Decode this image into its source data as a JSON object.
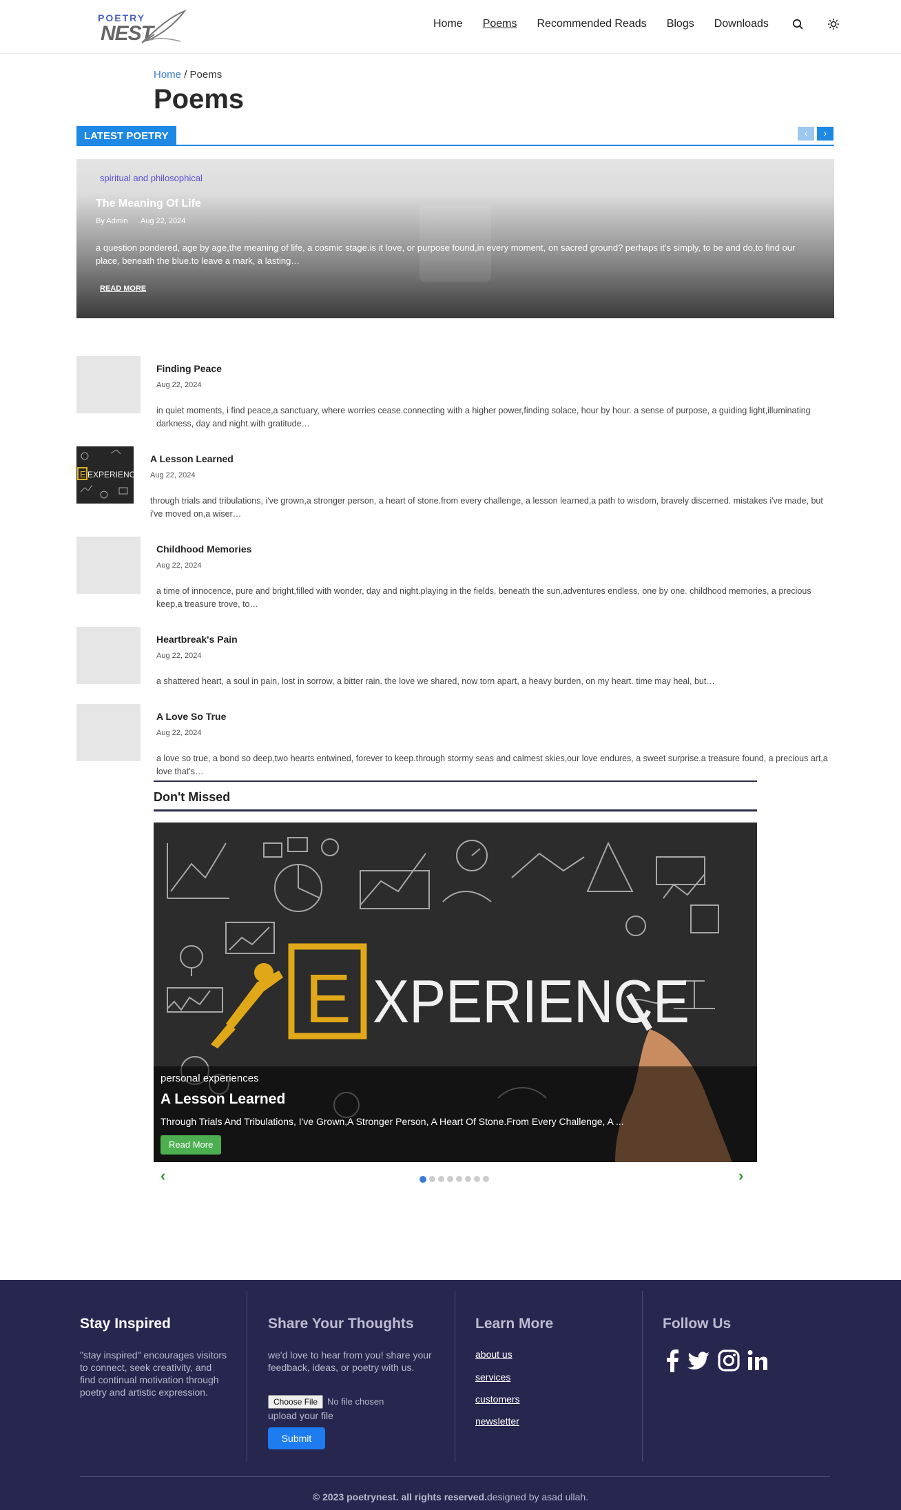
{
  "logo": {
    "line1": "POETRY",
    "line2": "NEST"
  },
  "nav": {
    "items": [
      "Home",
      "Poems",
      "Recommended Reads",
      "Blogs",
      "Downloads"
    ],
    "active": "Poems"
  },
  "breadcrumb": {
    "home": "Home",
    "sep": "/",
    "current": "Poems"
  },
  "page_title": "Poems",
  "latest": {
    "label": "LATEST POETRY",
    "prev": "‹",
    "next": "›"
  },
  "hero": {
    "category": "spiritual and philosophical",
    "title": "The Meaning Of Life",
    "author": "By  Admin",
    "date": "Aug 22, 2024",
    "excerpt": "a question pondered, age by age,the meaning of life, a cosmic stage.is it love, or purpose found,in every moment, on sacred ground? perhaps it's simply, to be and do,to find our place, beneath the blue.to leave a mark, a lasting…",
    "read_more": "READ MORE"
  },
  "posts": [
    {
      "title": "Finding Peace",
      "date": "Aug 22, 2024",
      "excerpt": "in quiet moments, i find peace,a sanctuary, where worries cease.connecting with a higher power,finding solace, hour by hour. a sense of purpose, a guiding light,illuminating darkness, day and night.with gratitude…"
    },
    {
      "title": "A Lesson Learned",
      "date": "Aug 22, 2024",
      "excerpt": "through trials and tribulations, i've grown,a stronger person, a heart of stone.from every challenge, a lesson learned,a path to wisdom, bravely discerned. mistakes i've made, but i've moved on,a wiser…"
    },
    {
      "title": "Childhood Memories",
      "date": "Aug 22, 2024",
      "excerpt": "a time of innocence, pure and bright,filled with wonder, day and night.playing in the fields, beneath the sun,adventures endless, one by one. childhood memories, a precious keep,a treasure trove, to…"
    },
    {
      "title": "Heartbreak's Pain",
      "date": "Aug 22, 2024",
      "excerpt": "a shattered heart, a soul in pain, lost in sorrow, a bitter rain. the love we shared, now torn apart, a heavy burden, on my heart. time may heal, but…"
    },
    {
      "title": "A Love So True",
      "date": "Aug 22, 2024",
      "excerpt": "a love so true, a bond so deep,two hearts entwined, forever to keep.through stormy seas and calmest skies,our love endures, a sweet surprise.a treasure found, a precious art,a love that's…"
    }
  ],
  "thumb_word": "EXPERIENC",
  "dont_missed": {
    "title": "Don't Missed",
    "image_word": "XPERIENCE",
    "image_letter": "E",
    "category": "personal experiences",
    "slide_title": "A Lesson Learned",
    "excerpt": "Through Trials And Tribulations, I've Grown,A Stronger Person, A Heart Of Stone.From Every Challenge, A ...",
    "button": "Read More",
    "prev": "‹",
    "next": "›",
    "dots_total": 8,
    "active_dot": 1
  },
  "footer": {
    "stay": {
      "title": "Stay Inspired",
      "text": "\"stay inspired\" encourages visitors to connect, seek creativity, and find continual motivation through poetry and artistic expression."
    },
    "share": {
      "title": "Share Your Thoughts",
      "text": "we'd love to hear from you! share your feedback, ideas, or poetry with us.",
      "file_button": "Choose File",
      "no_file": "No file chosen",
      "upload": "upload your file",
      "submit": "Submit"
    },
    "learn": {
      "title": "Learn More",
      "links": [
        "about us",
        "services",
        "customers",
        "newsletter"
      ]
    },
    "follow": {
      "title": "Follow Us",
      "icons": [
        "facebook-icon",
        "twitter-icon",
        "instagram-icon",
        "linkedin-icon"
      ]
    },
    "copyright_bold": "© 2023 poetrynest. all rights reserved.",
    "designed_by": "designed by asad ullah."
  }
}
